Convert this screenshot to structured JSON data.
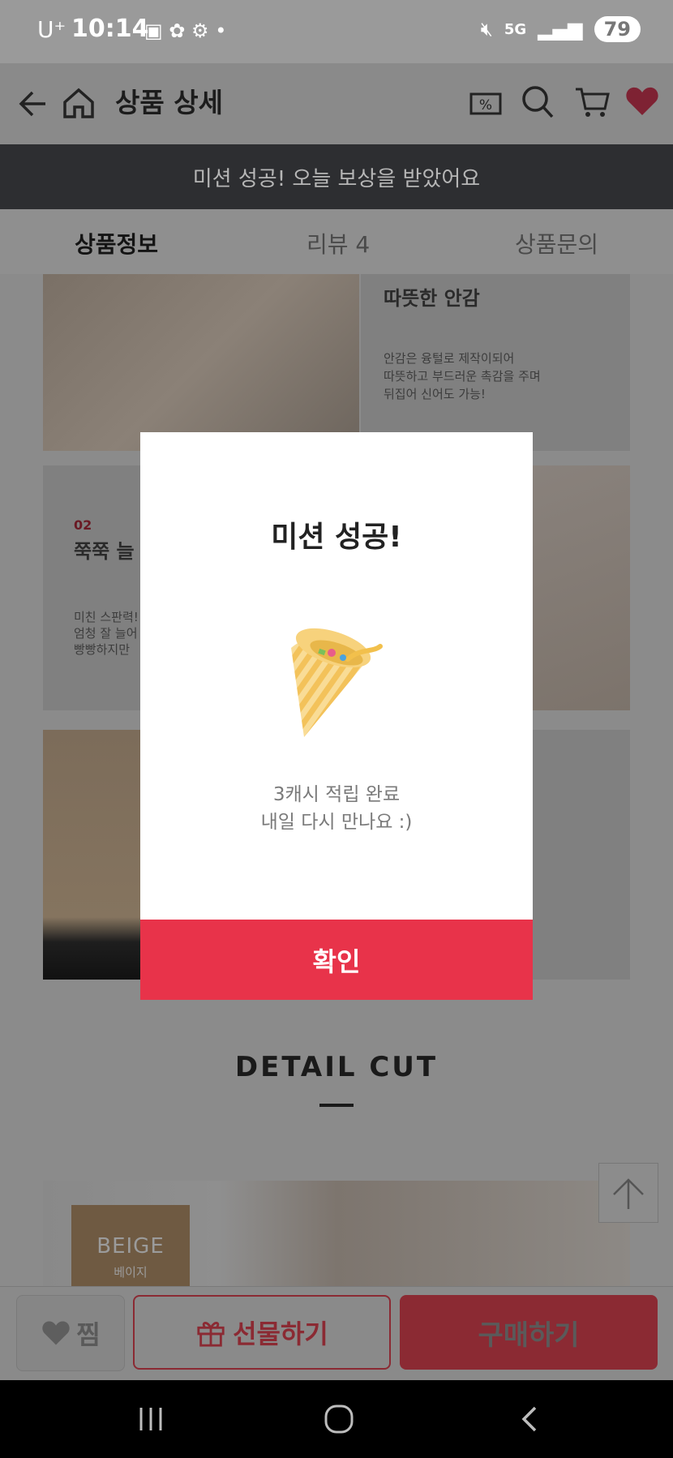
{
  "status_bar": {
    "carrier": "U⁺",
    "time": "10:14",
    "battery": "79",
    "network": "5G"
  },
  "header": {
    "title": "상품 상세"
  },
  "banner": {
    "text": "미션 성공! 오늘 보상을 받았어요"
  },
  "tabs": [
    {
      "label": "상품정보",
      "active": true
    },
    {
      "label": "리뷰 4",
      "active": false
    },
    {
      "label": "상품문의",
      "active": false
    }
  ],
  "content": {
    "section1_title": "따뜻한 안감",
    "section1_desc_1": "안감은 융털로 제작이되어",
    "section1_desc_2": "따뜻하고 부드러운 촉감을 주며",
    "section1_desc_3": "뒤집어 신어도 가능!",
    "section2_num": "02",
    "section2_title": "쭉쭉 늘",
    "section2_desc_1": "미친 스판력!",
    "section2_desc_2": "엄청 잘 늘어",
    "section2_desc_3": "빵빵하지만",
    "detail_cut": "DETAIL CUT",
    "beige_label": "BEIGE",
    "beige_sub": "베이지"
  },
  "modal": {
    "title": "미션 성공!",
    "message_line1": "3캐시 적립 완료",
    "message_line2": "내일 다시 만나요 :)",
    "confirm": "확인"
  },
  "bottom_bar": {
    "like": "찜",
    "gift": "선물하기",
    "buy": "구매하기"
  },
  "colors": {
    "accent": "#e8334a",
    "dim_accent": "#8b2a33",
    "banner_bg": "#2d2e31"
  }
}
